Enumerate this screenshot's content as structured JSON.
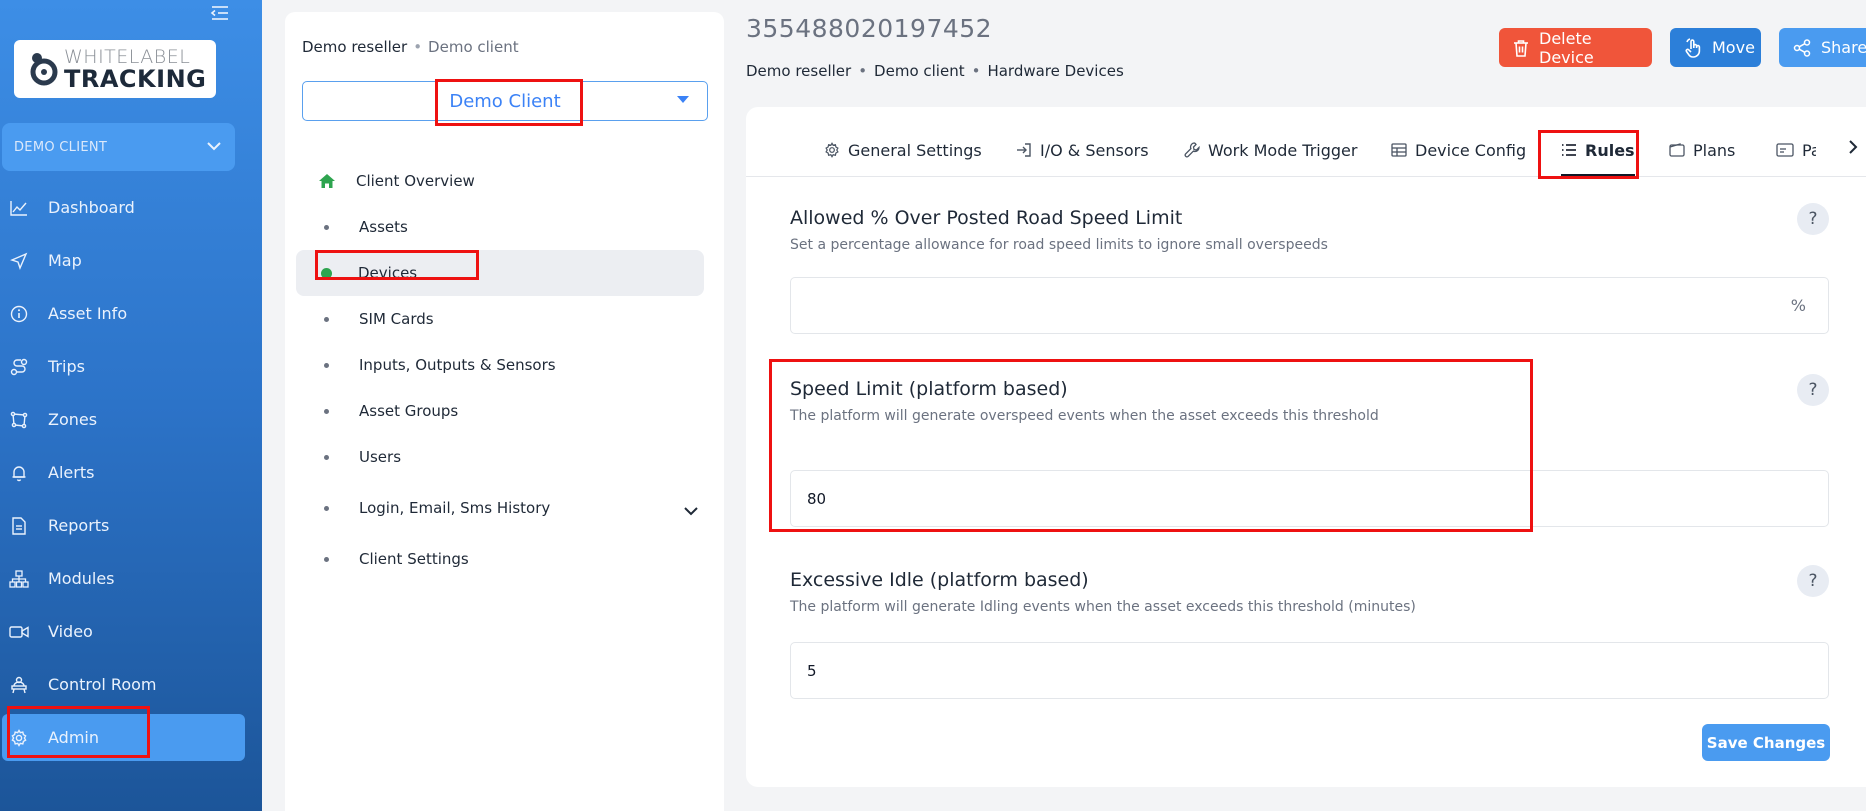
{
  "sidebar": {
    "logo": {
      "line1": "WHITELABEL",
      "line2": "TRACKING"
    },
    "client_select": "DEMO CLIENT",
    "items": [
      {
        "label": "Dashboard",
        "icon": "chart-line-icon"
      },
      {
        "label": "Map",
        "icon": "navigation-icon"
      },
      {
        "label": "Asset Info",
        "icon": "info-icon"
      },
      {
        "label": "Trips",
        "icon": "route-icon"
      },
      {
        "label": "Zones",
        "icon": "zone-icon"
      },
      {
        "label": "Alerts",
        "icon": "bell-icon"
      },
      {
        "label": "Reports",
        "icon": "report-icon"
      },
      {
        "label": "Modules",
        "icon": "modules-icon"
      },
      {
        "label": "Video",
        "icon": "video-icon"
      },
      {
        "label": "Control Room",
        "icon": "control-room-icon"
      },
      {
        "label": "Admin",
        "icon": "gear-icon"
      }
    ]
  },
  "client_panel": {
    "breadcrumb": {
      "reseller": "Demo reseller",
      "client": "Demo client"
    },
    "client_dropdown": "Demo Client",
    "menu": [
      {
        "label": "Client Overview"
      },
      {
        "label": "Assets"
      },
      {
        "label": "Devices"
      },
      {
        "label": "SIM Cards"
      },
      {
        "label": "Inputs, Outputs & Sensors"
      },
      {
        "label": "Asset Groups"
      },
      {
        "label": "Users"
      },
      {
        "label": "Login, Email, Sms History"
      },
      {
        "label": "Client Settings"
      }
    ]
  },
  "device": {
    "title": "355488020197452",
    "breadcrumb": {
      "reseller": "Demo reseller",
      "client": "Demo client",
      "section": "Hardware Devices"
    },
    "actions": {
      "delete": "Delete Device",
      "move": "Move",
      "share": "Share"
    }
  },
  "tabs": [
    {
      "label": "General Settings"
    },
    {
      "label": "I/O & Sensors"
    },
    {
      "label": "Work Mode Trigger"
    },
    {
      "label": "Device Config"
    },
    {
      "label": "Rules"
    },
    {
      "label": "Plans"
    },
    {
      "label": "Pa"
    }
  ],
  "rules": {
    "road_speed": {
      "title": "Allowed % Over Posted Road Speed Limit",
      "desc": "Set a percentage allowance for road speed limits to ignore small overspeeds",
      "value": "",
      "unit": "%"
    },
    "speed_limit": {
      "title": "Speed Limit (platform based)",
      "desc": "The platform will generate overspeed events when the asset exceeds this threshold",
      "value": "80"
    },
    "idle": {
      "title": "Excessive Idle (platform based)",
      "desc": "The platform will generate Idling events when the asset exceeds this threshold (minutes)",
      "value": "5"
    },
    "help": "?",
    "save": "Save Changes"
  },
  "colors": {
    "accent": "#4a9bf0",
    "danger": "#f0553a",
    "highlight": "#ee1111"
  }
}
